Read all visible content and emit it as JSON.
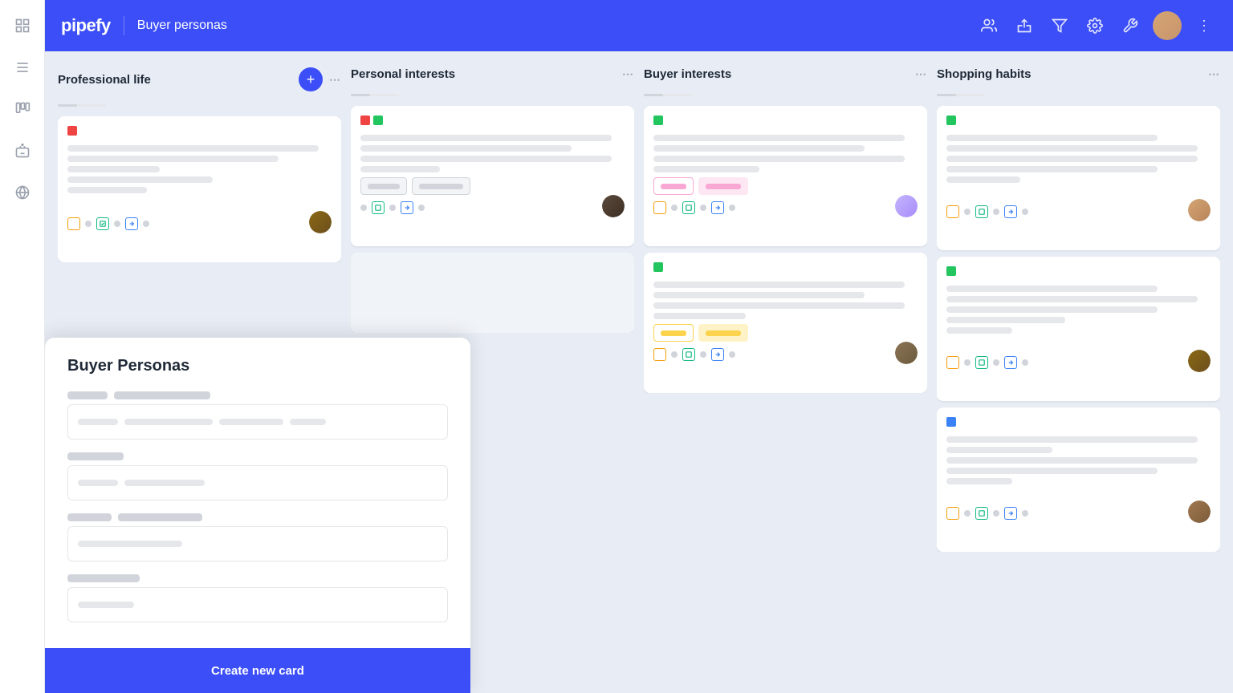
{
  "app": {
    "name": "pipefy",
    "board_title": "Buyer personas"
  },
  "header": {
    "logo": "pipefy",
    "title": "Buyer personas",
    "actions": [
      "members-icon",
      "share-icon",
      "filter-icon",
      "settings-icon",
      "wrench-icon"
    ]
  },
  "sidebar": {
    "items": [
      {
        "id": "grid",
        "icon": "grid-icon"
      },
      {
        "id": "list",
        "icon": "list-icon"
      },
      {
        "id": "kanban",
        "icon": "kanban-icon"
      },
      {
        "id": "bot",
        "icon": "bot-icon"
      },
      {
        "id": "globe",
        "icon": "globe-icon"
      }
    ]
  },
  "columns": [
    {
      "id": "professional-life",
      "title": "Professional life",
      "has_add_btn": true,
      "cards": [
        {
          "id": "card-1",
          "tag_color": "#ef4444",
          "lines": [
            "long",
            "long",
            "short",
            "medium",
            "xshort"
          ],
          "has_avatar": true,
          "avatar_face": "face-1",
          "footer_icons": [
            "orange",
            "green",
            "blue"
          ],
          "has_dot": true
        }
      ]
    },
    {
      "id": "personal-interests",
      "title": "Personal interests",
      "has_add_btn": false,
      "cards": [
        {
          "id": "card-2",
          "tag_colors": [
            "#ef4444",
            "#22c55e"
          ],
          "lines": [
            "long",
            "long",
            "long",
            "short"
          ],
          "has_badge_outline": true,
          "badge_text": "",
          "badge_type": "outline",
          "has_avatar": true,
          "avatar_face": "face-2",
          "footer_icons": [
            "green",
            "blue"
          ],
          "has_dot": true
        }
      ]
    },
    {
      "id": "buyer-interests",
      "title": "Buyer interests",
      "has_add_btn": false,
      "cards": [
        {
          "id": "card-3",
          "tag_color": "#22c55e",
          "lines": [
            "long",
            "long",
            "long",
            "short",
            "medium"
          ],
          "badge1": "pink-outline",
          "badge2": "pink-fill",
          "has_avatar": true,
          "avatar_face": "face-3",
          "footer_icons": [
            "orange",
            "green",
            "blue"
          ],
          "has_dot": true
        },
        {
          "id": "card-4",
          "tag_color": "#22c55e",
          "lines": [
            "long",
            "long",
            "medium",
            "short"
          ],
          "badge1": "yellow-outline",
          "badge2": "yellow-fill",
          "has_avatar": true,
          "avatar_face": "face-4",
          "footer_icons": [
            "orange",
            "green",
            "blue"
          ],
          "has_dot": true
        }
      ]
    },
    {
      "id": "shopping-habits",
      "title": "Shopping habits",
      "has_add_btn": false,
      "cards": [
        {
          "id": "card-5",
          "tag_color": "#22c55e",
          "lines": [
            "medium",
            "long",
            "long",
            "medium",
            "short"
          ],
          "has_avatar": true,
          "avatar_face": "face-5",
          "footer_icons": [
            "orange",
            "green",
            "blue"
          ],
          "has_dot": true
        },
        {
          "id": "card-6",
          "tag_color": "#22c55e",
          "lines": [
            "medium",
            "long",
            "medium",
            "short",
            "xshort"
          ],
          "has_avatar": true,
          "avatar_face": "face-1",
          "footer_icons": [
            "orange",
            "green",
            "blue"
          ],
          "has_dot": true
        },
        {
          "id": "card-7",
          "tag_color": "#3b82f6",
          "lines": [
            "long",
            "short",
            "long",
            "medium",
            "xshort"
          ],
          "has_avatar": true,
          "avatar_face": "face-2",
          "footer_icons": [
            "orange",
            "green",
            "blue"
          ],
          "has_dot": true
        }
      ]
    }
  ],
  "form": {
    "title": "Buyer Personas",
    "submit_label": "Create new card",
    "fields": [
      {
        "id": "field-1",
        "label_blocks": [
          50,
          120
        ],
        "input_placeholder_width": "60%",
        "multi": true,
        "num_input_placeholders": 4
      },
      {
        "id": "field-2",
        "label_blocks": [
          70
        ],
        "input_placeholder_width": "50%"
      },
      {
        "id": "field-3",
        "label_blocks": [
          60,
          110
        ],
        "input_placeholder_width": "55%"
      },
      {
        "id": "field-4",
        "label_blocks": [
          90
        ],
        "input_placeholder_width": "40%"
      }
    ]
  }
}
